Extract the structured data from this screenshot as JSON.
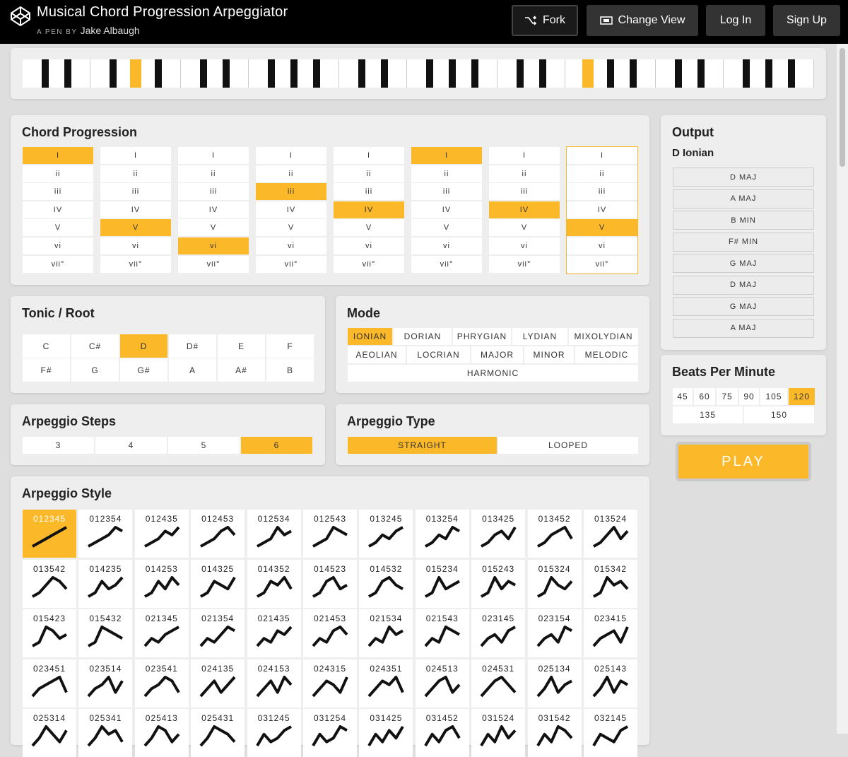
{
  "header": {
    "title": "Musical Chord Progression Arpeggiator",
    "byline_prefix": "A PEN BY",
    "author": "Jake Albaugh",
    "fork": "Fork",
    "change_view": "Change View",
    "login": "Log In",
    "signup": "Sign Up"
  },
  "piano": {
    "active_white_keys": [],
    "active_black_keys": [
      3,
      17
    ]
  },
  "chord_progression": {
    "title": "Chord Progression",
    "numerals": [
      "I",
      "ii",
      "iii",
      "IV",
      "V",
      "vi",
      "vii°"
    ],
    "selected": [
      0,
      4,
      5,
      2,
      3,
      0,
      3,
      4
    ],
    "current_column": 7
  },
  "output": {
    "title": "Output",
    "mode_name": "D Ionian",
    "chords": [
      "D MAJ",
      "A MAJ",
      "B MIN",
      "F# MIN",
      "G MAJ",
      "D MAJ",
      "G MAJ",
      "A MAJ"
    ]
  },
  "tonic": {
    "title": "Tonic / Root",
    "notes": [
      "C",
      "C#",
      "D",
      "D#",
      "E",
      "F",
      "F#",
      "G",
      "G#",
      "A",
      "A#",
      "B"
    ],
    "selected": "D"
  },
  "mode": {
    "title": "Mode",
    "row1": [
      "IONIAN",
      "DORIAN",
      "PHRYGIAN",
      "LYDIAN",
      "MIXOLYDIAN"
    ],
    "row2": [
      "AEOLIAN",
      "LOCRIAN",
      "MAJOR",
      "MINOR",
      "MELODIC"
    ],
    "row3": [
      "HARMONIC"
    ],
    "selected": "IONIAN"
  },
  "bpm": {
    "title": "Beats Per Minute",
    "row1": [
      "45",
      "60",
      "75",
      "90",
      "105",
      "120"
    ],
    "row2": [
      "135",
      "150"
    ],
    "selected": "120"
  },
  "play": "PLAY",
  "steps": {
    "title": "Arpeggio Steps",
    "options": [
      "3",
      "4",
      "5",
      "6"
    ],
    "selected": "6"
  },
  "type": {
    "title": "Arpeggio Type",
    "options": [
      "STRAIGHT",
      "LOOPED"
    ],
    "selected": "STRAIGHT"
  },
  "style": {
    "title": "Arpeggio Style",
    "patterns": [
      "012345",
      "012354",
      "012435",
      "012453",
      "012534",
      "012543",
      "013245",
      "013254",
      "013425",
      "013452",
      "013524",
      "013542",
      "014235",
      "014253",
      "014325",
      "014352",
      "014523",
      "014532",
      "015234",
      "015243",
      "015324",
      "015342",
      "015423",
      "015432",
      "021345",
      "021354",
      "021435",
      "021453",
      "021534",
      "021543",
      "023145",
      "023154",
      "023415",
      "023451",
      "023514",
      "023541",
      "024135",
      "024153",
      "024315",
      "024351",
      "024513",
      "024531",
      "025134",
      "025143",
      "025314",
      "025341",
      "025413",
      "025431",
      "031245",
      "031254",
      "031425",
      "031452",
      "031524",
      "031542",
      "032145"
    ],
    "selected": "012345"
  },
  "colors": {
    "accent": "#fbb829",
    "header_bg": "#000000",
    "panel": "#eeeeee"
  }
}
